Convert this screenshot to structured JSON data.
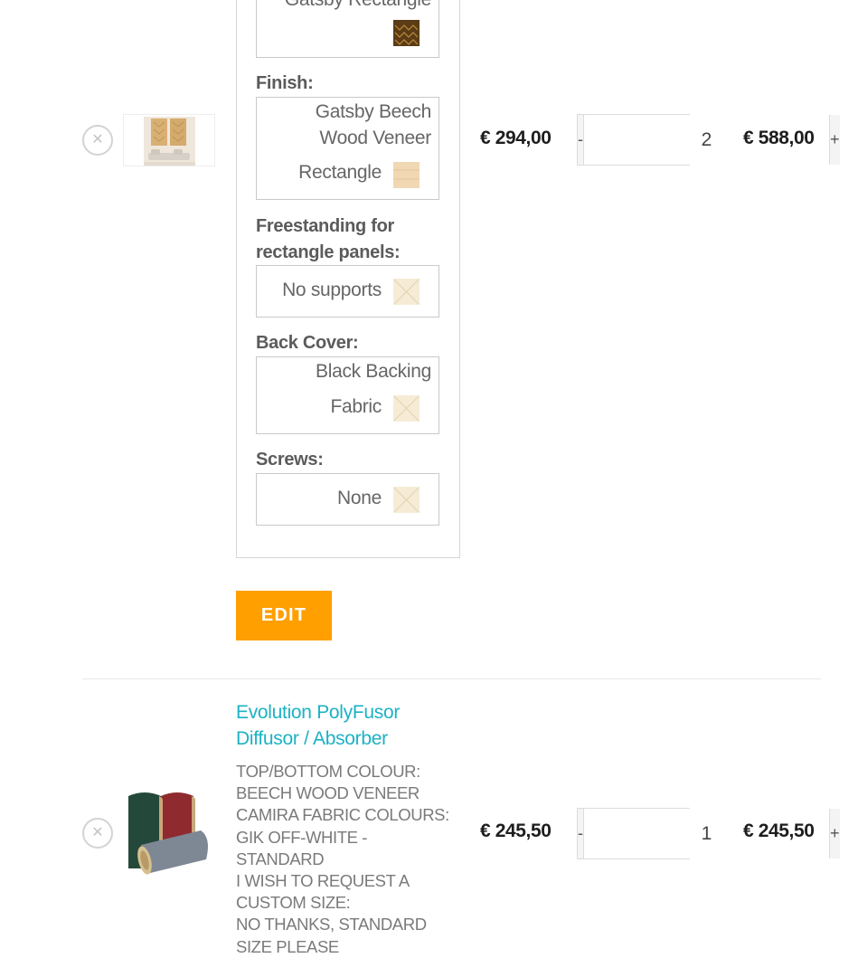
{
  "cart": {
    "items": [
      {
        "remove_icon": "close-icon",
        "thumbnail_icon": "product-thumbnail-wall-panels",
        "options": {
          "top_partial_text": "Gatsby Rectangle",
          "finish": {
            "label": "Finish:",
            "value_line1": "Gatsby Beech",
            "value_line2": "Wood Veneer",
            "value_line3": "Rectangle"
          },
          "freestanding": {
            "label_line1": "Freestanding for",
            "label_line2": "rectangle panels:",
            "value": "No supports"
          },
          "back_cover": {
            "label": "Back Cover:",
            "value_line1": "Black Backing",
            "value_line2": "Fabric"
          },
          "screws": {
            "label": "Screws:",
            "value": "None"
          }
        },
        "edit_label": "EDIT",
        "price": "€ 294,00",
        "quantity": {
          "minus": "-",
          "value": "2",
          "plus": "+"
        },
        "subtotal": "€ 588,00"
      },
      {
        "remove_icon": "close-icon",
        "thumbnail_icon": "product-thumbnail-polyfusor",
        "title": "Evolution PolyFusor Diffusor / Absorber",
        "title_line1": "Evolution PolyFusor",
        "title_line2": "Diffusor / Absorber",
        "meta_lines": [
          "TOP/BOTTOM COLOUR:",
          "BEECH WOOD VENEER",
          "CAMIRA FABRIC COLOURS:",
          "GIK OFF-WHITE -",
          "STANDARD",
          "I WISH TO REQUEST A",
          "CUSTOM SIZE:",
          "NO THANKS, STANDARD",
          "SIZE PLEASE"
        ],
        "price": "€ 245,50",
        "quantity": {
          "minus": "-",
          "value": "1",
          "plus": "+"
        },
        "subtotal": "€ 245,50"
      }
    ]
  },
  "colors": {
    "accent_orange": "#ff9f00",
    "link_teal": "#1cb2c4",
    "price_text": "#1d1d1d"
  }
}
